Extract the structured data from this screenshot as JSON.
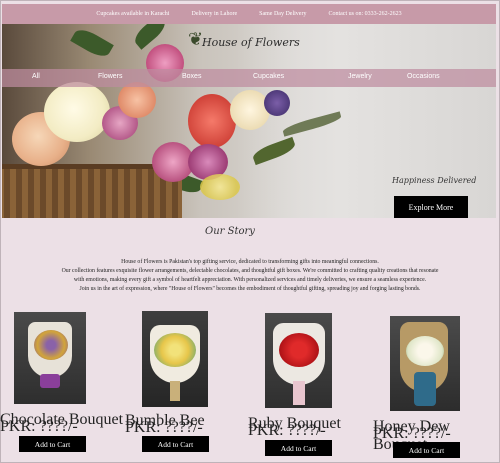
{
  "topbar": {
    "items": [
      "Cupcakes available in Karachi",
      "Delivery in Lahore",
      "Same Day Delivery",
      "Contact us on: 0333-262-2623"
    ]
  },
  "header": {
    "logo": "House of Flowers"
  },
  "nav": {
    "items": [
      "All",
      "Flowers",
      "Boxes",
      "Cupcakes",
      "Jewelry",
      "Occasions"
    ]
  },
  "hero": {
    "tagline": "Happiness Delivered",
    "cta": "Explore More"
  },
  "story": {
    "title": "Our Story",
    "lines": [
      "House of Flowers is Pakistan's top gifting service, dedicated to transforming gifts into meaningful connections.",
      "Our collection features exquisite flower arrangements, delectable chocolates, and thoughtful gift boxes. We're committed to crafting quality creations that resonate",
      "with emotions, making every gift a symbol of heartfelt appreciation. With personalized services and timely deliveries, we ensure a seamless experience.",
      "Join us in the art of expression, where \"House of Flowers\" becomes the embodiment of thoughtful gifting, spreading joy and forging lasting bonds."
    ]
  },
  "products": [
    {
      "name": "Chocolate Bouquet",
      "price": "PKR: ????/-",
      "button": "Add to Cart"
    },
    {
      "name": "Bumble Bee",
      "price": "PKR: ????/-",
      "button": "Add to Cart"
    },
    {
      "name": "Ruby Bouquet",
      "price": "PKR: ????/-",
      "button": "Add to Cart"
    },
    {
      "name": "Honey Dew Bouquet",
      "price": "PKR: ????/-",
      "button": "Add to Cart"
    }
  ],
  "colors": {
    "page_bg": "#ece0e6",
    "topbar_bg": "#c79aa8",
    "button_bg": "#000000"
  }
}
